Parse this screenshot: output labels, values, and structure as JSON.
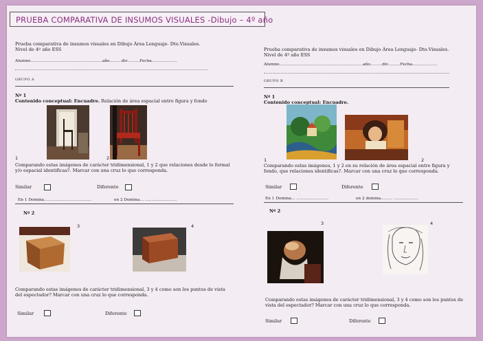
{
  "title": "PRUEBA COMPARATIVA DE INSUMOS VISUALES -Dibujo – 4º año",
  "left": {
    "intro": "Prueba comparativa de insumos visuales en Dibujo Área Lenguaje- Dto.Visuales.",
    "level": "Nivel de 4º año ESS",
    "student_line": "Alumno………………………………………………año………div………Fecha……………….",
    "group": "GRUPO A",
    "n1_title": "Nº 1",
    "n1_content_label": "Contenido conceptual: Encuadre.",
    "n1_content_rest": " Relación de área espacial entre figura y fondo",
    "img1_num": "1",
    "img2_num": "2",
    "q1": "Comparando estas imágenes de carácter tridimensional, 1 y 2 que relaciones desde lo formal y/o espacial identificas?. Marcar con una cruz lo que corresponda.",
    "similar": "Similar",
    "diferente": "Diferente",
    "domina": "En 1 Domina………………………………",
    "domina2": "en 2 Domina… ……………………",
    "n2_title": "Nº 2",
    "img3_num": "3",
    "img4_num": "4",
    "q2": "Comparando estas imágenes de carácter tridimensional, 3 y 4 como son los puntos de vista del espectador? Marcar con una cruz lo que corresponda.",
    "similar2": "Similar",
    "diferente2": "Diferente"
  },
  "right": {
    "intro": "Prueba comparativa de insumos visuales en Dibujo Área Lenguaje- Dto.Visuales.",
    "level": "Nivel de 4º año ESS",
    "student_line": "Alumno………………………………………………………año………div………Fecha……………….",
    "group": "GRUPO B",
    "n1_title": "Nº 1",
    "n1_content_label": "Contenido conceptual: Encuadre.",
    "img1_num": "1",
    "img2_num": "2",
    "q1": "Comparando estas imágenes, 1 y 2 en su relación de área espacial entre figura y fondo, que relaciones identificas?. Marcar con una cruz lo que corresponda.",
    "similar": "Similar",
    "diferente": "Diferente",
    "domina": "En 1 Domina… ……………………",
    "domina2": "en 2 domina……… ………………",
    "n2_title": "Nº 2",
    "img3_num": "3",
    "img4_num": "4",
    "q2": "Comparando estas imágenes de carácter tridimensional, 3 y 4 como son los puntos de vista del espectador? Marcar con una cruz lo que corresponda.",
    "similar2": "Similar",
    "diferente2": "Diferente"
  }
}
